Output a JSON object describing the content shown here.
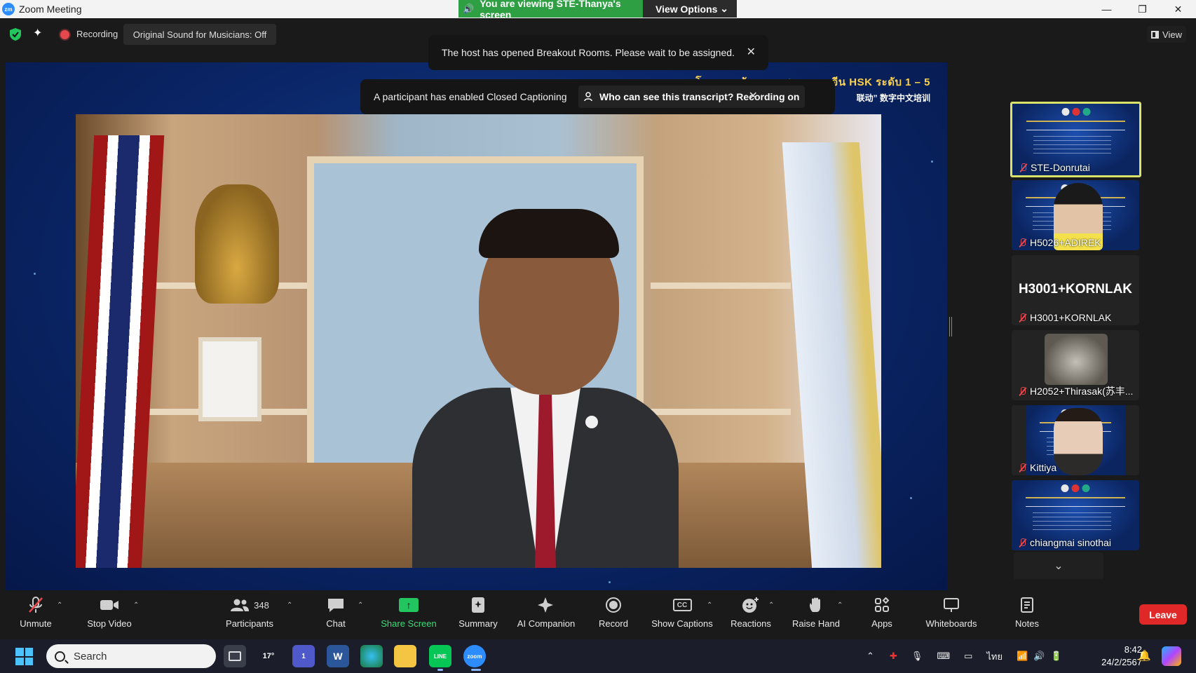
{
  "window": {
    "title": "Zoom Meeting",
    "logo_text": "zm"
  },
  "share_banner": {
    "text": "You are viewing STE-Thanya's screen",
    "view_options_label": "View Options"
  },
  "top_bar": {
    "recording_label": "Recording",
    "original_sound_label": "Original Sound for Musicians: Off",
    "view_label": "View"
  },
  "notifications": {
    "breakout": "The host has opened Breakout Rooms. Please wait to be assigned.",
    "captioning": "A participant has enabled Closed Captioning",
    "transcript_link": "Who can see this transcript? Recording on"
  },
  "shared_screen": {
    "heading": "โครงการพัฒนาครูสอนภาษาจีน HSK ระดับ 1 – 5",
    "subheading": "联动” 数字中文培训"
  },
  "participants": [
    {
      "name": "STE-Donrutai",
      "muted": true,
      "active_speaker": true,
      "tile": "slide"
    },
    {
      "name": "H5026+ADIREK",
      "muted": true,
      "active_speaker": false,
      "tile": "video-man"
    },
    {
      "name": "H3001+KORNLAK",
      "muted": true,
      "active_speaker": false,
      "tile": "name",
      "center_text": "H3001+KORNLAK"
    },
    {
      "name": "H2052+Thirasak(苏丰...",
      "muted": true,
      "active_speaker": false,
      "tile": "avatar"
    },
    {
      "name": "Kittiya",
      "muted": true,
      "active_speaker": false,
      "tile": "video-woman"
    },
    {
      "name": "chiangmai sinothai",
      "muted": true,
      "active_speaker": false,
      "tile": "slide"
    }
  ],
  "toolbar": {
    "unmute": "Unmute",
    "stop_video": "Stop Video",
    "participants": "Participants",
    "participant_count": "348",
    "chat": "Chat",
    "share_screen": "Share Screen",
    "summary": "Summary",
    "ai_companion": "AI Companion",
    "record": "Record",
    "show_captions": "Show Captions",
    "cc_text": "CC",
    "reactions": "Reactions",
    "raise_hand": "Raise Hand",
    "apps": "Apps",
    "whiteboards": "Whiteboards",
    "notes": "Notes",
    "leave": "Leave"
  },
  "taskbar": {
    "search_placeholder": "Search",
    "weather_temp": "17°",
    "teams_badge": "1",
    "word_label": "W",
    "line_label": "LINE",
    "zoom_label": "zoom",
    "language": "ไทย",
    "time": "8:42",
    "date": "24/2/2567"
  },
  "colors": {
    "share_green": "#2ea043",
    "leave_red": "#e02828",
    "active_speaker_border": "#d9e36a",
    "share_screen_green": "#22c55e"
  }
}
